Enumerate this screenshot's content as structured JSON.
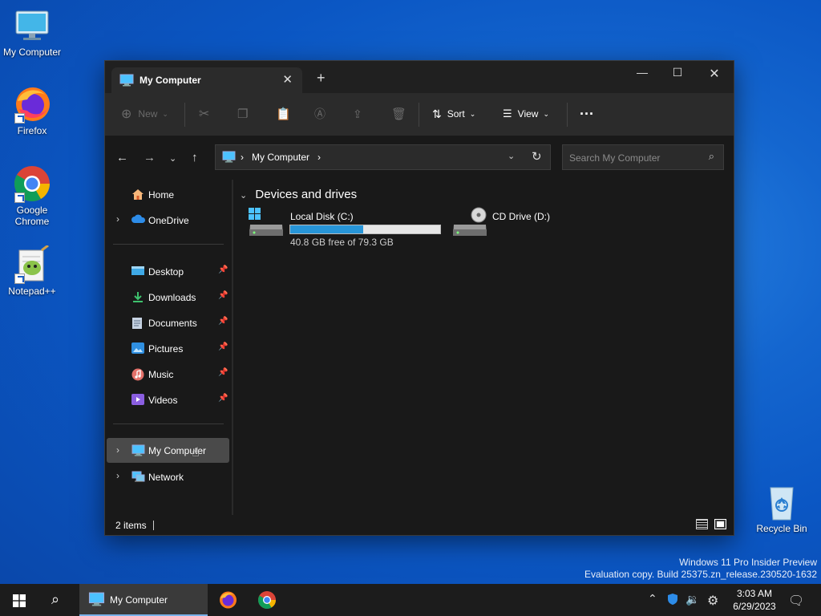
{
  "desktop": {
    "icons": [
      {
        "label": "My Computer"
      },
      {
        "label": "Firefox"
      },
      {
        "label": "Google Chrome"
      },
      {
        "label": "Notepad++"
      },
      {
        "label": "Recycle Bin"
      }
    ],
    "watermark_line1": "Windows 11 Pro Insider Preview",
    "watermark_line2": "Evaluation copy. Build 25375.zn_release.230520-1632"
  },
  "window": {
    "tab_title": "My Computer",
    "toolbar": {
      "new_label": "New",
      "sort_label": "Sort",
      "view_label": "View"
    },
    "address": {
      "crumb": "My Computer"
    },
    "search": {
      "placeholder": "Search My Computer"
    },
    "sidebar": {
      "home": "Home",
      "onedrive": "OneDrive",
      "quick": [
        {
          "label": "Desktop"
        },
        {
          "label": "Downloads"
        },
        {
          "label": "Documents"
        },
        {
          "label": "Pictures"
        },
        {
          "label": "Music"
        },
        {
          "label": "Videos"
        }
      ],
      "mycomputer": "My Computer",
      "network": "Network"
    },
    "content": {
      "group_title": "Devices and drives",
      "drives": [
        {
          "name": "Local Disk (C:)",
          "detail": "40.8 GB free of 79.3 GB",
          "used_fraction": 0.485
        },
        {
          "name": "CD Drive (D:)"
        }
      ]
    },
    "status": {
      "items": "2 items"
    }
  },
  "taskbar": {
    "window_label": "My Computer",
    "time": "3:03 AM",
    "date": "6/29/2023"
  },
  "colors": {
    "accent": "#2795d8",
    "window_bg": "#191919",
    "toolbar_bg": "#2b2b2b"
  }
}
